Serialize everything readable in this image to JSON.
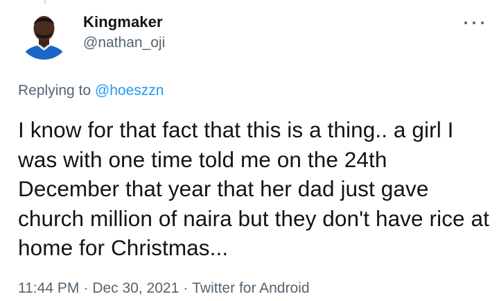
{
  "tweet": {
    "author": {
      "display_name": "Kingmaker",
      "handle": "@nathan_oji"
    },
    "replying_prefix": "Replying to ",
    "replying_to": "@hoeszzn",
    "text": "I know for that fact that this is a thing.. a girl I was with one time told me on the 24th December that year that her dad just gave church million of naira but they don't have rice at home for Christmas...",
    "time": "11:44 PM",
    "separator": "·",
    "date": "Dec 30, 2021",
    "source": "Twitter for Android",
    "more_icon": "more-horizontal-icon"
  },
  "colors": {
    "text_primary": "#0f1419",
    "text_secondary": "#536471",
    "link": "#1d9bf0",
    "avatar_background": "#1b67c9"
  }
}
